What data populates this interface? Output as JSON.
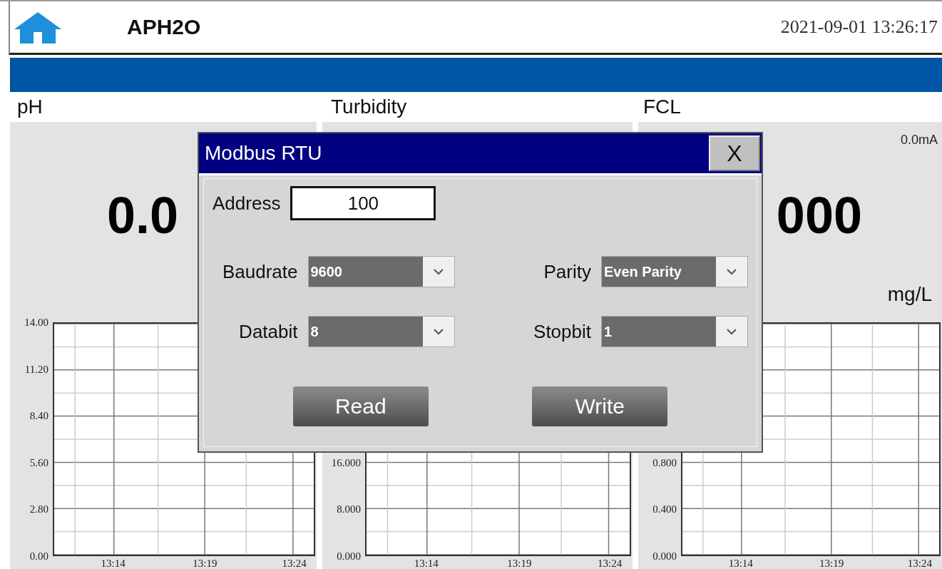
{
  "header": {
    "title": "APH2O",
    "datetime": "2021-09-01 13:26:17"
  },
  "panels": [
    {
      "label": "pH",
      "value": "0.0",
      "axis": {
        "y_labels": [
          "14.00",
          "11.20",
          "8.40",
          "5.60",
          "2.80",
          "0.00"
        ],
        "x_labels": [
          "13:14",
          "13:19",
          "13:24"
        ]
      }
    },
    {
      "label": "Turbidity",
      "axis": {
        "y_labels": [
          "16.000",
          "8.000",
          "0.000"
        ],
        "x_labels": [
          "13:14",
          "13:19",
          "13:24"
        ]
      }
    },
    {
      "label": "FCL",
      "current": "0.0mA",
      "value": "000",
      "unit": "mg/L",
      "axis": {
        "y_labels": [
          "0.800",
          "0.400",
          "0.000"
        ],
        "x_labels": [
          "13:14",
          "13:19",
          "13:24"
        ]
      }
    }
  ],
  "dialog": {
    "title": "Modbus RTU",
    "close": "X",
    "address": {
      "label": "Address",
      "value": "100"
    },
    "selects": [
      {
        "label": "Baudrate",
        "value": "9600"
      },
      {
        "label": "Parity",
        "value": "Even Parity"
      },
      {
        "label": "Databit",
        "value": "8"
      },
      {
        "label": "Stopbit",
        "value": "1"
      }
    ],
    "buttons": [
      "Read",
      "Write"
    ]
  }
}
